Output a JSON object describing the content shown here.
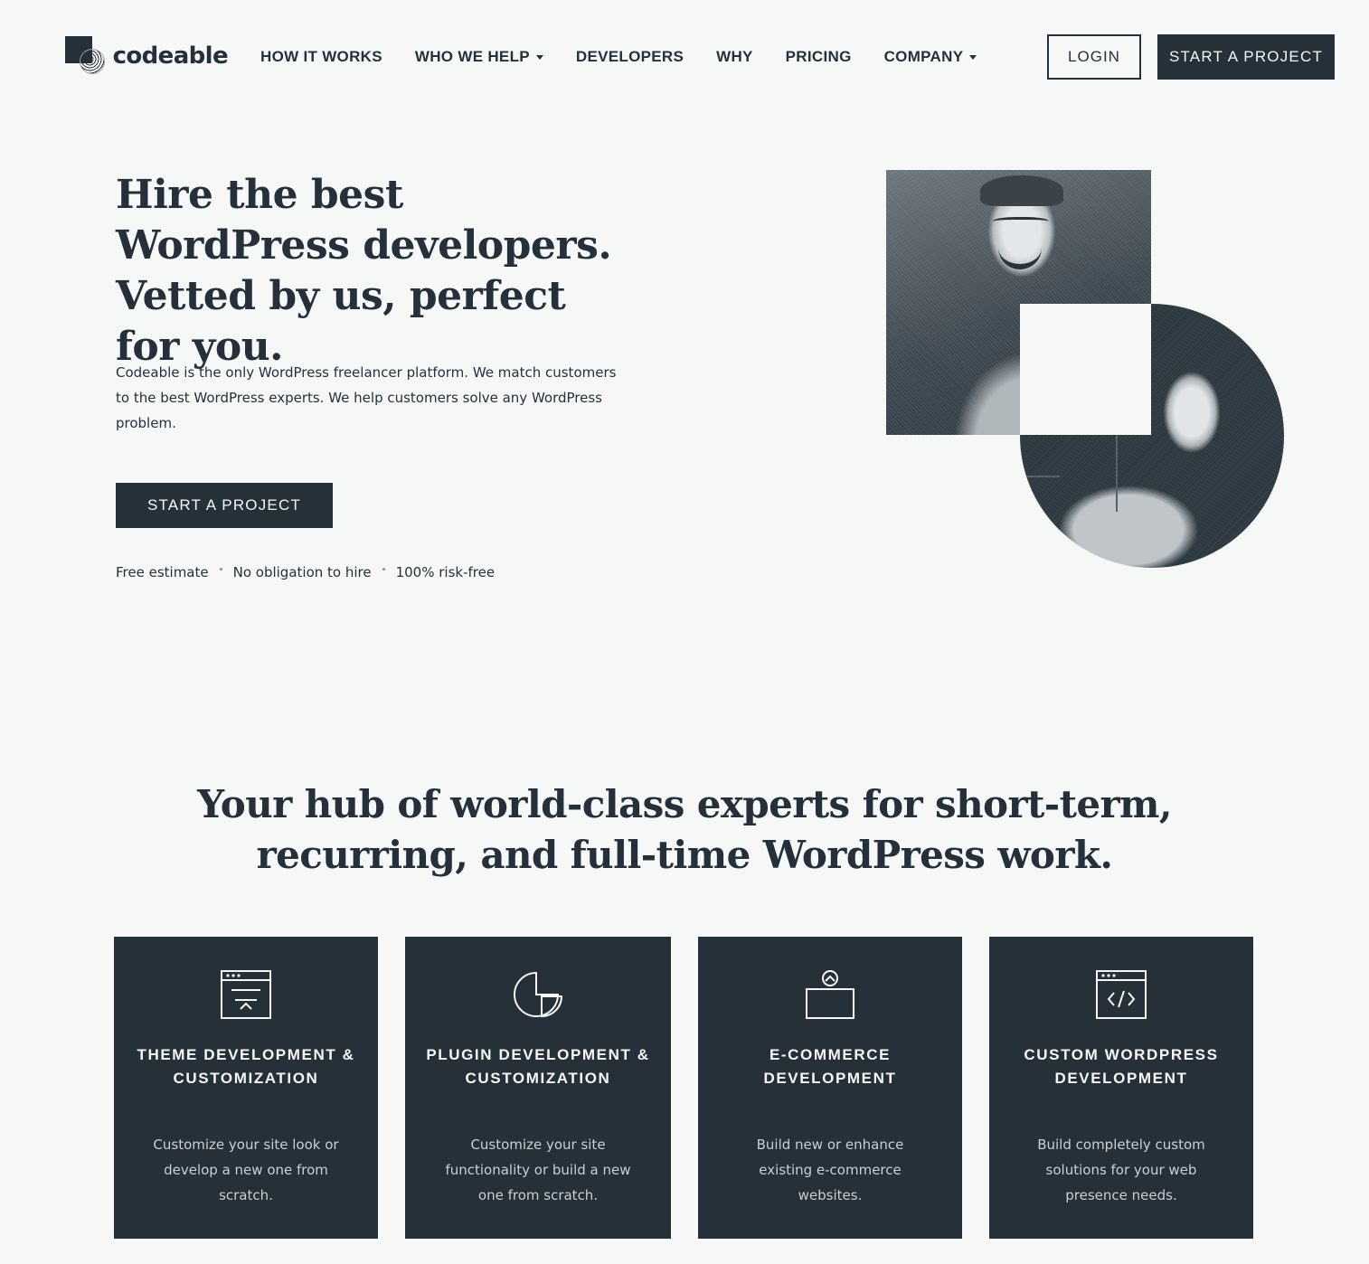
{
  "brand": {
    "name": "codeable"
  },
  "nav": {
    "items": [
      {
        "label": "HOW IT WORKS",
        "has_caret": false
      },
      {
        "label": "WHO WE HELP",
        "has_caret": true
      },
      {
        "label": "DEVELOPERS",
        "has_caret": false
      },
      {
        "label": "WHY",
        "has_caret": false
      },
      {
        "label": "PRICING",
        "has_caret": false
      },
      {
        "label": "COMPANY",
        "has_caret": true
      }
    ],
    "login_label": "LOGIN",
    "start_label": "START A PROJECT"
  },
  "hero": {
    "title": "Hire the best WordPress developers. Vetted by us, perfect for you.",
    "description": "Codeable is the only WordPress freelancer platform. We match customers to the best WordPress experts. We help customers solve any WordPress problem.",
    "cta_label": "START A PROJECT",
    "perks": [
      "Free estimate",
      "No obligation to hire",
      "100% risk-free"
    ]
  },
  "services": {
    "title": "Your hub of world-class experts for short-term, recurring, and full-time WordPress work.",
    "cards": [
      {
        "icon": "browser-theme-icon",
        "title": "THEME DEVELOPMENT & CUSTOMIZATION",
        "description": "Customize your site look or develop a new one from scratch."
      },
      {
        "icon": "pie-chart-plugin-icon",
        "title": "PLUGIN DEVELOPMENT & CUSTOMIZATION",
        "description": "Customize your site functionality or build a new one from scratch."
      },
      {
        "icon": "shopping-bag-icon",
        "title": "E-COMMERCE DEVELOPMENT",
        "description": "Build new or enhance existing e-commerce websites."
      },
      {
        "icon": "browser-code-icon",
        "title": "CUSTOM WORDPRESS DEVELOPMENT",
        "description": "Build completely custom solutions for your web presence needs."
      }
    ]
  },
  "colors": {
    "dark": "#253039",
    "background": "#f6f8f8",
    "card_text_muted": "#c9cfd3"
  }
}
